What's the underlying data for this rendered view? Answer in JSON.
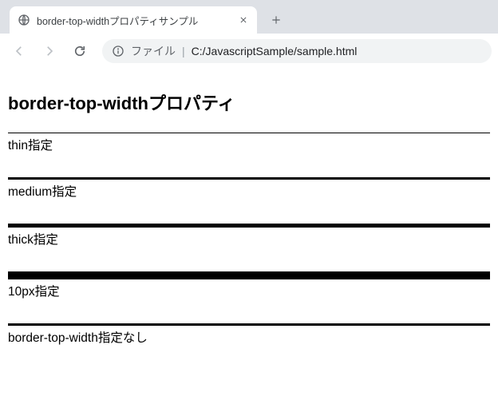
{
  "browser": {
    "tab_title": "border-top-widthプロパティサンプル",
    "address_prefix": "ファイル",
    "address_path": "C:/JavascriptSample/sample.html"
  },
  "page": {
    "heading": "border-top-widthプロパティ",
    "samples": [
      {
        "label": "thin指定"
      },
      {
        "label": "medium指定"
      },
      {
        "label": "thick指定"
      },
      {
        "label": "10px指定"
      },
      {
        "label": "border-top-width指定なし"
      }
    ]
  }
}
